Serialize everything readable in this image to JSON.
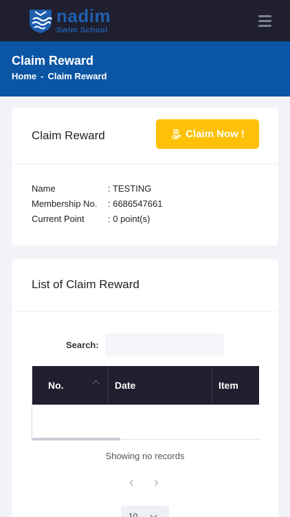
{
  "brand": {
    "name": "nadim",
    "subtitle": "Swim School",
    "color": "#1f5fae"
  },
  "header": {
    "title": "Claim Reward",
    "breadcrumb": {
      "home": "Home",
      "separator": "-",
      "current": "Claim Reward"
    },
    "color": "#0b56a4"
  },
  "claim_card": {
    "title": "Claim Reward",
    "button_label": "Claim Now !",
    "button_icon": "gift-hand-icon",
    "button_color": "#ffc107",
    "info": [
      {
        "label": "Name",
        "value": ": TESTING"
      },
      {
        "label": "Membership No.",
        "value": ": 6686547661"
      },
      {
        "label": "Current Point",
        "value": ": 0 point(s)"
      }
    ]
  },
  "list_card": {
    "title": "List of Claim Reward",
    "search_label": "Search:",
    "search_value": "",
    "columns": [
      "No.",
      "Date",
      "Item"
    ],
    "rows": [],
    "empty_text": "Showing no records",
    "pager": {
      "prev": "‹",
      "next": "›"
    },
    "per_page": "10"
  }
}
